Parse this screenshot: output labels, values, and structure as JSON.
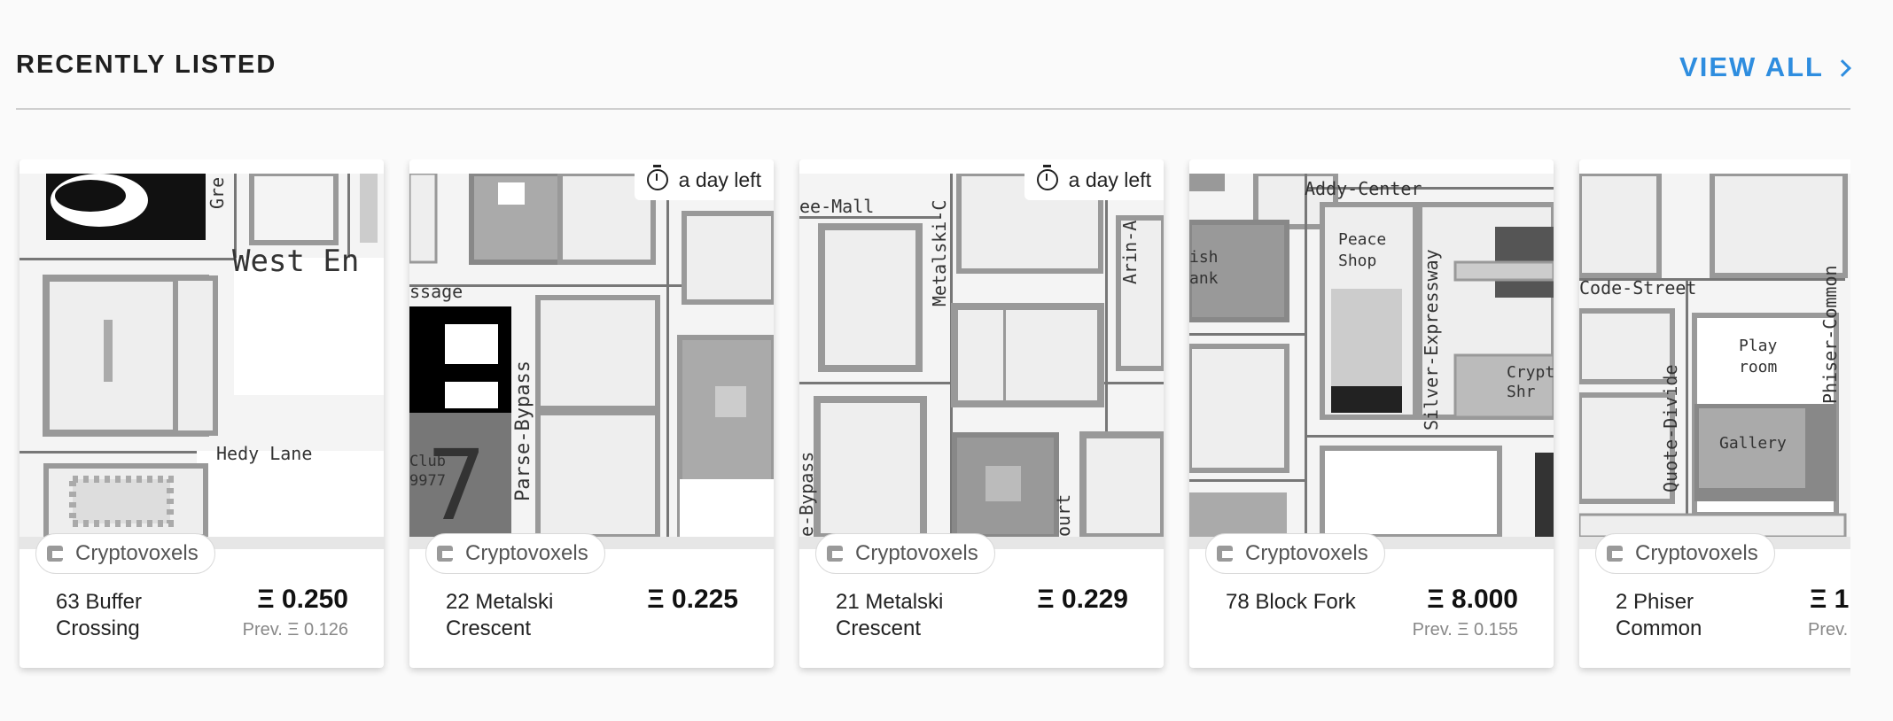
{
  "section": {
    "title": "RECENTLY LISTED",
    "view_all_label": "VIEW ALL"
  },
  "colors": {
    "accent": "#2e8ddf"
  },
  "cards": [
    {
      "platform": "Cryptovoxels",
      "name": "63 Buffer Crossing",
      "price": "Ξ 0.250",
      "prev": "Prev. Ξ 0.126",
      "timer": "",
      "map_labels": [
        "West En",
        "Hedy Lane",
        "Gre"
      ]
    },
    {
      "platform": "Cryptovoxels",
      "name": "22 Metalski Crescent",
      "price": "Ξ 0.225",
      "prev": "",
      "timer": "a day left",
      "map_labels": [
        "ssage",
        "Parse-Bypass",
        "Club",
        "9977"
      ]
    },
    {
      "platform": "Cryptovoxels",
      "name": "21 Metalski Crescent",
      "price": "Ξ 0.229",
      "prev": "",
      "timer": "a day left",
      "map_labels": [
        "ee-Mall",
        "Metalski-C",
        "Arin-A",
        "e-Bypass",
        "ourt"
      ]
    },
    {
      "platform": "Cryptovoxels",
      "name": "78 Block Fork",
      "price": "Ξ 8.000",
      "prev": "Prev. Ξ 0.155",
      "timer": "",
      "map_labels": [
        "Addy-Center",
        "Peace",
        "Shop",
        "Silver-Expressway",
        "Crypt",
        "Shr",
        "ish",
        "ank"
      ]
    },
    {
      "platform": "Cryptovoxels",
      "name": "2 Phiser Common",
      "price": "Ξ 1",
      "prev": "Prev.",
      "timer": "",
      "map_labels": [
        "Code-Street",
        "Quote-Divide",
        "Phiser-Common",
        "Play",
        "room",
        "Gallery"
      ]
    }
  ]
}
